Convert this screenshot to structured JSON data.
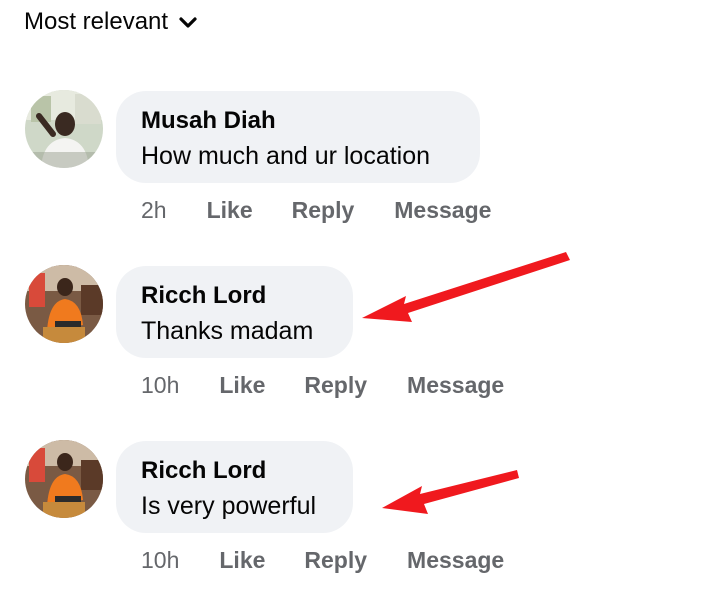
{
  "sort": {
    "label": "Most relevant"
  },
  "comments": [
    {
      "author": "Musah Diah",
      "text": "How much and ur location",
      "time": "2h",
      "like": "Like",
      "reply": "Reply",
      "message": "Message"
    },
    {
      "author": "Ricch Lord",
      "text": "Thanks madam",
      "time": "10h",
      "like": "Like",
      "reply": "Reply",
      "message": "Message"
    },
    {
      "author": "Ricch Lord",
      "text": "Is very powerful",
      "time": "10h",
      "like": "Like",
      "reply": "Reply",
      "message": "Message"
    }
  ],
  "colors": {
    "bubble": "#f0f2f5",
    "meta": "#65676b",
    "annotation_arrow": "#f0191e"
  }
}
